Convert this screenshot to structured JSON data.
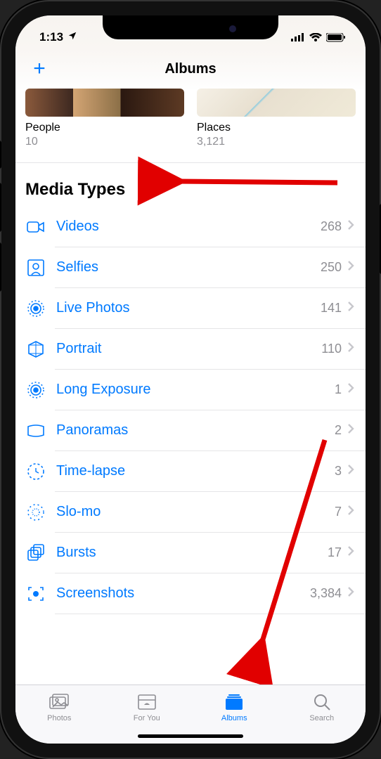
{
  "status": {
    "time": "1:13"
  },
  "navbar": {
    "title": "Albums"
  },
  "albums": {
    "people": {
      "name": "People",
      "count": "10"
    },
    "places": {
      "name": "Places",
      "count": "3,121"
    }
  },
  "section": {
    "media_types": "Media Types"
  },
  "media": [
    {
      "icon": "video-icon",
      "label": "Videos",
      "count": "268"
    },
    {
      "icon": "selfies-icon",
      "label": "Selfies",
      "count": "250"
    },
    {
      "icon": "live-photos-icon",
      "label": "Live Photos",
      "count": "141"
    },
    {
      "icon": "portrait-icon",
      "label": "Portrait",
      "count": "110"
    },
    {
      "icon": "long-exposure-icon",
      "label": "Long Exposure",
      "count": "1"
    },
    {
      "icon": "panoramas-icon",
      "label": "Panoramas",
      "count": "2"
    },
    {
      "icon": "time-lapse-icon",
      "label": "Time-lapse",
      "count": "3"
    },
    {
      "icon": "slo-mo-icon",
      "label": "Slo-mo",
      "count": "7"
    },
    {
      "icon": "bursts-icon",
      "label": "Bursts",
      "count": "17"
    },
    {
      "icon": "screenshots-icon",
      "label": "Screenshots",
      "count": "3,384"
    }
  ],
  "tabs": {
    "photos": "Photos",
    "for_you": "For You",
    "albums": "Albums",
    "search": "Search"
  }
}
